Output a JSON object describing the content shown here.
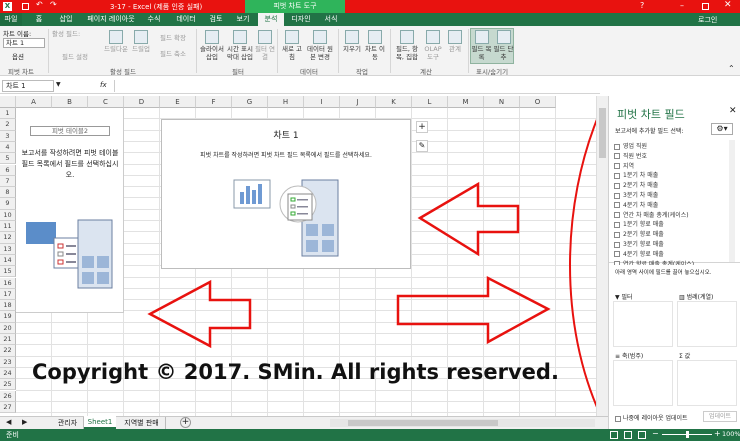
{
  "window": {
    "doc_title": "3-17 - Excel (제품 인증 실패)",
    "context_title": "피벗 차트 도구",
    "user": "로그인"
  },
  "tabs": [
    "파일",
    "홈",
    "삽입",
    "페이지 레이아웃",
    "수식",
    "데이터",
    "검토",
    "보기",
    "분석",
    "디자인",
    "서식"
  ],
  "ribbon": {
    "chart_name_label": "차트 이름:",
    "chart_name_value": "차트 1",
    "options": "옵션",
    "active_field_label": "활성 필드:",
    "field_settings": "필드 설정",
    "drill_down": "드릴다운",
    "drill_up": "드릴업",
    "expand": "필드 확장",
    "collapse": "필드 축소",
    "slicer": "슬라이서 삽입",
    "timeline": "시간 표시 막대 삽입",
    "filter_conn": "필터 연결",
    "refresh": "새로 고침",
    "change_source": "데이터 원본 변경",
    "clear": "지우기",
    "move_chart": "차트 이동",
    "fields_items": "필드, 항목, 집합",
    "olap": "OLAP 도구",
    "relations": "관계",
    "field_list": "필드 목록",
    "field_buttons": "필드 단추",
    "groups": [
      "피벗 차트",
      "활성 필드",
      "필터",
      "데이터",
      "작업",
      "계산",
      "표시/숨기기"
    ]
  },
  "formula": {
    "name_box": "차트 1",
    "fx": "fx"
  },
  "columns": [
    "A",
    "B",
    "C",
    "D",
    "E",
    "F",
    "G",
    "H",
    "I",
    "J",
    "K",
    "L",
    "M",
    "N",
    "O"
  ],
  "rows": [
    "1",
    "2",
    "3",
    "4",
    "5",
    "6",
    "7",
    "8",
    "9",
    "10",
    "11",
    "12",
    "13",
    "14",
    "15",
    "16",
    "17",
    "18",
    "19",
    "20",
    "21",
    "22",
    "23",
    "24",
    "25",
    "26",
    "27"
  ],
  "pivot_table": {
    "title": "피벗 테이블2",
    "message": "보고서를 작성하려면 피벗 테이블 필드 목록에서 필드를 선택하십시오."
  },
  "chart": {
    "title": "차트 1",
    "message": "피벗 차트를 작성하려면 피벗 차트 필드 목록에서 필드를 선택하세요."
  },
  "copyright": "Copyright © 2017. SMin. All rights reserved.",
  "sheet_tabs": [
    "관리자",
    "Sheet1",
    "지역별 판매"
  ],
  "active_sheet": "Sheet1",
  "panel": {
    "title": "피벗 차트 필드",
    "choose_label": "보고서에 추가할 필드 선택:",
    "fields": [
      "영업 직원",
      "직원 번호",
      "지역",
      "1분기 차 매출",
      "2분기 차 매출",
      "3분기 차 매출",
      "4분기 차 매출",
      "연간 차 매출 총계(케이스)",
      "1분기 향료 매출",
      "2분기 향료 매출",
      "3분기 향료 매출",
      "4분기 향료 매출"
    ],
    "last_field_partial": "연간 향료 매출 총계(케이스)",
    "drag_label": "아래 영역 사이에 필드를 끌어 놓으십시오.",
    "filter": "필터",
    "legend": "범례(계열)",
    "axis": "축(범주)",
    "values": "값",
    "defer": "나중에 레이아웃 업데이트",
    "update": "업데이트"
  },
  "status": {
    "ready": "준비",
    "zoom": "100%"
  },
  "colors": {
    "excel_green": "#217346",
    "arrow_red": "#e8120f"
  }
}
